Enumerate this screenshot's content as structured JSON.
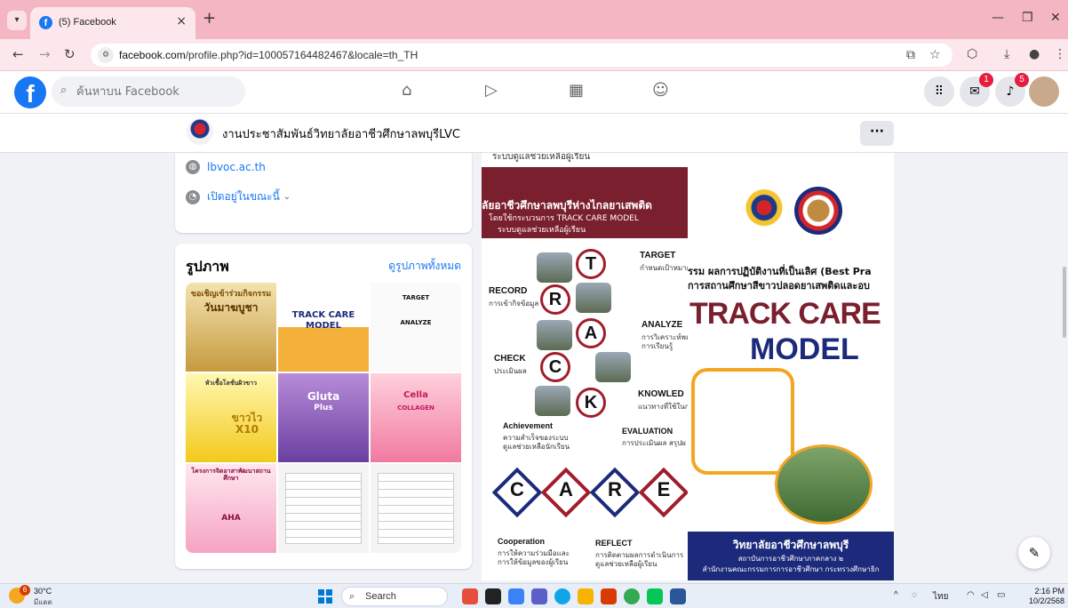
{
  "browser": {
    "tab_title": "(5) Facebook",
    "url_host": "facebook.com",
    "url_path": "/profile.php?id=100057164482467&locale=th_TH"
  },
  "fb": {
    "search_placeholder": "ค้นหาบน Facebook",
    "messenger_badge": "1",
    "notifications_badge": "5"
  },
  "page": {
    "name": "งานประชาสัมพันธ์วิทยาลัยอาชีวศึกษาลพบุรีLVC",
    "website": "lbvoc.ac.th",
    "open_status": "เปิดอยู่ในขณะนี้"
  },
  "photos": {
    "title": "รูปภาพ",
    "see_all": "ดูรูปภาพทั้งหมด",
    "thumbs": [
      {
        "line1": "ขอเชิญเข้าร่วมกิจกรรม",
        "line2": "วันมาฆบูชา"
      },
      {
        "line1": "TRACK CARE",
        "line2": "MODEL"
      },
      {
        "line1": "TARGET",
        "line2": "ANALYZE"
      },
      {
        "line1": "หัวเชื้อโลชั่นผิวขาว",
        "line2": "ขาวไว X10"
      },
      {
        "line1": "Gluta",
        "line2": "Plus"
      },
      {
        "line1": "Cella",
        "line2": "COLLAGEN"
      },
      {
        "line1": "โครงการจิตอาสาพัฒนาสถานศึกษา",
        "line2": "AHA"
      }
    ]
  },
  "poster_left": {
    "top_text": "ระบบดูแลช่วยเหลือผู้เรียน",
    "headline": "ลัยอาชีวศึกษาลพบุรีห่างไกลยาเสพติด",
    "line2": "โดยใช้กระบวนการ TRACK CARE MODEL",
    "line3": "ระบบดูแลช่วยเหลือผู้เรียน",
    "track_letters": [
      "T",
      "R",
      "A",
      "C",
      "K"
    ],
    "target": "TARGET",
    "target_sub": "กำหนดเป้าหมายฯ",
    "record": "RECORD",
    "record_sub": "การเข้ากิจข้อมูล",
    "analyze": "ANALYZE",
    "analyze_sub": "การวิเคราะห์พฤติ",
    "analyze_sub2": "การเรียนรู้",
    "check": "CHECK",
    "check_sub": "ประเมินผล",
    "knowledge": "KNOWLED",
    "knowledge_sub": "แนวทางที่ใช้ในการ",
    "achievement": "Achievement",
    "achievement_sub": "ความสำเร็จของระบบ",
    "achievement_sub2": "ดูแลช่วยเหลือนักเรียน",
    "evaluation": "EVALUATION",
    "evaluation_sub": "การประเมินผล สรุปผ",
    "care_letters": [
      "C",
      "A",
      "R",
      "E"
    ],
    "cooperation": "Cooperation",
    "cooperation_sub": "การให้ความร่วมมือและ",
    "cooperation_sub2": "การให้ข้อมูลของผู้เรียน",
    "reflect": "REFLECT",
    "reflect_sub": "การติดตามผลการดำเนินการ",
    "reflect_sub2": "ดูแลช่วยเหลือผู้เรียน"
  },
  "poster_right": {
    "line1": "รรม ผลการปฏิบัติงานที่เป็นเลิศ (Best Pra",
    "line2": "การสถานศึกษาสีขาวปลอดยาเสพติดและอบ",
    "big1": "TRACK CARE",
    "big2": "MODEL",
    "college": "วิทยาลัยอาชีวศึกษาลพบุรี",
    "sub1": "สถาบันการอาชีวศึกษาภาคกลาง ๒",
    "sub2": "สำนักงานคณะกรรมการการอาชีวศึกษา กระทรวงศึกษาธิก"
  },
  "taskbar": {
    "temp": "30°C",
    "condition": "มีแดด",
    "weather_badge": "6",
    "search": "Search",
    "lang": "ไทย",
    "time": "2:16 PM",
    "date": "10/2/2568"
  },
  "colors": {
    "fb_blue": "#1877f2",
    "tab_strip": "#f4b6c2",
    "poster_maroon": "#7a1f2d",
    "poster_navy": "#1b2a7a"
  }
}
